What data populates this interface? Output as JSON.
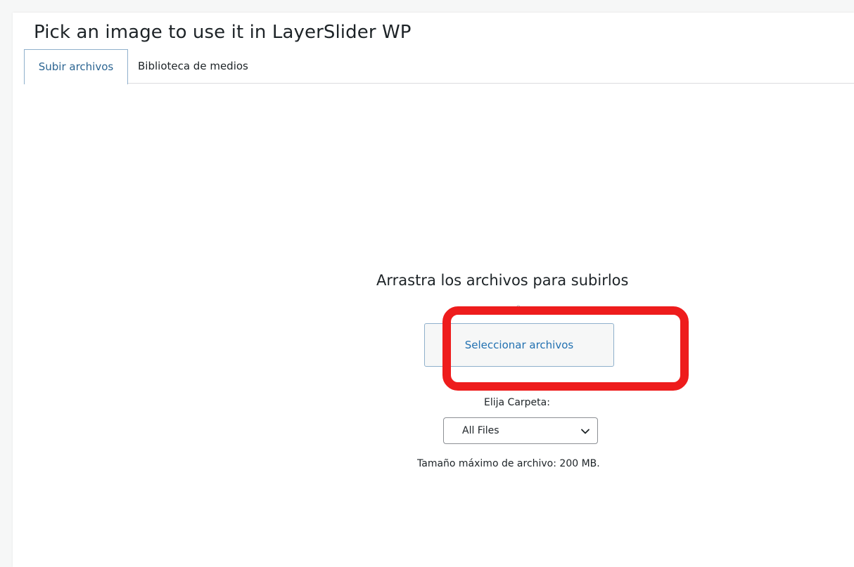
{
  "modal": {
    "title": "Pick an image to use it in LayerSlider WP"
  },
  "tabs": [
    {
      "label": "Subir archivos",
      "active": true
    },
    {
      "label": "Biblioteca de medios",
      "active": false
    }
  ],
  "uploader": {
    "drop_title": "Arrastra los archivos para subirlos",
    "or_text": "o",
    "select_button_label": "Seleccionar archivos",
    "folder_label": "Elija Carpeta:",
    "folder_selected": "All Files",
    "max_size_text": "Tamaño máximo de archivo: 200 MB."
  },
  "annotation": {
    "highlight_color": "#ee1c1c"
  },
  "colors": {
    "accent": "#2271b1",
    "tab_border": "#8fb0cc"
  }
}
